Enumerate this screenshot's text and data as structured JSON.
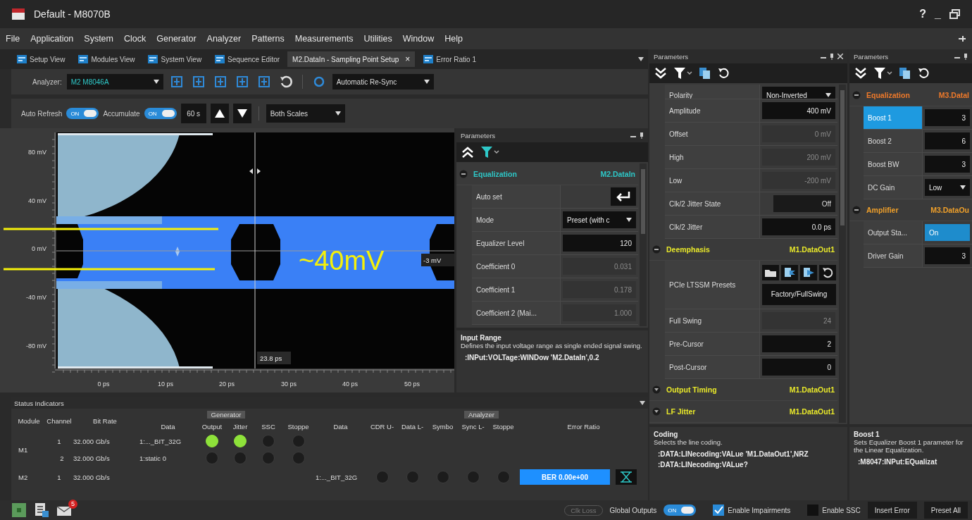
{
  "window": {
    "title": "Default - M8070B",
    "controls": [
      "?",
      "_"
    ]
  },
  "menu": [
    "File",
    "Application",
    "System",
    "Clock",
    "Generator",
    "Analyzer",
    "Patterns",
    "Measurements",
    "Utilities",
    "Window",
    "Help"
  ],
  "tabs": [
    {
      "label": "Setup View",
      "selected": false
    },
    {
      "label": "Modules View",
      "selected": false
    },
    {
      "label": "System View",
      "selected": false
    },
    {
      "label": "Sequence Editor",
      "selected": false
    },
    {
      "label": "M2.DataIn - Sampling Point Setup",
      "selected": true,
      "close": "×"
    },
    {
      "label": "Error Ratio 1",
      "selected": false
    }
  ],
  "toolbar": {
    "analyzer_label": "Analyzer:",
    "analyzer": "M2 M8046A",
    "resync": "Automatic Re-Sync"
  },
  "acquisition": {
    "toggles": [
      {
        "label": "Auto Refresh",
        "on": true,
        "text": "ON"
      },
      {
        "label": "Accumulate",
        "on": true,
        "text": "ON"
      }
    ],
    "interval": "60 s",
    "scale": "Both Scales"
  },
  "plot": {
    "y_labels": [
      "80 mV",
      "40 mV",
      "0 mV",
      "-40 mV",
      "-80 mV"
    ],
    "x_labels": [
      "0 ps",
      "10 ps",
      "20 ps",
      "30 ps",
      "40 ps",
      "50 ps"
    ],
    "time_cursor": "23.8 ps",
    "voltage_cursor": "-3 mV",
    "annotation": "~40mV"
  },
  "panels": [
    {
      "title": "Parameters",
      "sections": [
        {
          "name": "Equalization",
          "target": "M2.DataIn",
          "color": "#2ec8c8",
          "expanded": true,
          "rows": [
            {
              "label": "Auto set",
              "kind": "button"
            },
            {
              "label": "Mode",
              "kind": "select",
              "value": "Preset (with c"
            },
            {
              "label": "Equalizer Level",
              "kind": "input",
              "value": "120"
            },
            {
              "label": "Coefficient 0",
              "kind": "readonly",
              "value": "0.031"
            },
            {
              "label": "Coefficient 1",
              "kind": "readonly",
              "value": "0.178"
            },
            {
              "label": "Coefficient 2 (Mai...",
              "kind": "readonly",
              "value": "1.000"
            }
          ]
        }
      ],
      "help": {
        "title": "Input Range",
        "text": "Defines the input voltage range as single ended signal swing.",
        "commands": [
          ":INPut:VOLTage:WINDow 'M2.DataIn',0.2"
        ]
      }
    },
    {
      "title": "Parameters",
      "sections": [
        {
          "rows": [
            {
              "label": "Polarity",
              "kind": "select",
              "value": "Non-Inverted"
            },
            {
              "label": "Amplitude",
              "kind": "input",
              "value": "400 mV"
            },
            {
              "label": "Offset",
              "kind": "readonly",
              "value": "0 mV"
            },
            {
              "label": "High",
              "kind": "readonly",
              "value": "200 mV"
            },
            {
              "label": "Low",
              "kind": "readonly",
              "value": "-200 mV"
            },
            {
              "label": "Clk/2 Jitter State",
              "kind": "toggle",
              "on": false,
              "text": "Off"
            },
            {
              "label": "Clk/2 Jitter",
              "kind": "input",
              "value": "0.0 ps"
            }
          ]
        },
        {
          "name": "Deemphasis",
          "target": "M1.DataOut1",
          "color": "#e8e82a",
          "expanded": true,
          "rows": [
            {
              "label": "PCIe LTSSM Presets",
              "kind": "presets",
              "value": "Factory/FullSwing"
            },
            {
              "label": "Full Swing",
              "kind": "readonly",
              "value": "24"
            },
            {
              "label": "Pre-Cursor",
              "kind": "input",
              "value": "2"
            },
            {
              "label": "Post-Cursor",
              "kind": "input",
              "value": "0"
            }
          ]
        },
        {
          "name": "Output Timing",
          "target": "M1.DataOut1",
          "color": "#e8e82a",
          "expanded": false
        },
        {
          "name": "LF Jitter",
          "target": "M1.DataOut1",
          "color": "#e8e82a",
          "expanded": false
        }
      ],
      "help": {
        "title": "Coding",
        "text": "Selects the line coding.",
        "commands": [
          ":DATA:LINecoding:VALue 'M1.DataOut1',NRZ",
          ":DATA:LINecoding:VALue?"
        ]
      }
    },
    {
      "title": "Parameters",
      "sections": [
        {
          "name": "Equalization",
          "target": "M3.DataI",
          "color": "#f07a2a",
          "expanded": true,
          "rows": [
            {
              "label": "Boost 1",
              "kind": "input",
              "value": "3",
              "selected": true
            },
            {
              "label": "Boost 2",
              "kind": "input",
              "value": "6",
              "selected": false
            },
            {
              "label": "Boost BW",
              "kind": "input",
              "value": "3",
              "selected": false
            },
            {
              "label": "DC Gain",
              "kind": "select",
              "value": "Low",
              "selected": false
            }
          ]
        },
        {
          "name": "Amplifier",
          "target": "M3.DataOu",
          "color": "#f0a02a",
          "expanded": true,
          "rows": [
            {
              "label": "Output Sta...",
              "kind": "toggle",
              "on": true,
              "text": "On",
              "selected": false
            },
            {
              "label": "Driver Gain",
              "kind": "input",
              "value": "3",
              "selected": false
            }
          ]
        }
      ],
      "help": {
        "title": "Boost 1",
        "text": "Sets Equalizer Boost 1 parameter for the Linear Equalization.",
        "commands": [
          ":M8047:INPut:EQualizat"
        ]
      }
    }
  ],
  "status": {
    "title": "Status Indicators",
    "module_head": "Module",
    "channel_head": "Channel",
    "rate_head": "Bit Rate",
    "generator": {
      "title": "Generator",
      "columns": [
        "Data",
        "Output",
        "Jitter",
        "SSC",
        "Stoppe"
      ]
    },
    "analyzer": {
      "title": "Analyzer",
      "columns": [
        "Data",
        "CDR U-",
        "Data L-",
        "Symbo",
        "Sync L-",
        "Stoppe",
        "Error Ratio"
      ]
    },
    "modules": [
      {
        "name": "M1",
        "channels": [
          {
            "channel": "1",
            "rate": "32.000 Gb/s",
            "gen_data": "1:..._BIT_32G",
            "gen_leds": [
              true,
              true,
              false,
              false
            ]
          },
          {
            "channel": "2",
            "rate": "32.000 Gb/s",
            "gen_data": "1:static 0",
            "gen_leds": [
              false,
              false,
              false,
              false
            ]
          }
        ]
      },
      {
        "name": "M2",
        "channels": [
          {
            "channel": "1",
            "rate": "32.000 Gb/s",
            "ana_data": "1:..._BIT_32G",
            "ana_leds": [
              false,
              false,
              false,
              false,
              false
            ],
            "ber": "BER 0.00e+00"
          }
        ]
      }
    ]
  },
  "footer": {
    "badge": "5",
    "clk_loss": {
      "label": "Clk Loss",
      "disabled": true
    },
    "global_outputs": {
      "label": "Global Outputs",
      "on": true,
      "text": "ON"
    },
    "checks": [
      {
        "label": "Enable Impairments",
        "checked": true
      },
      {
        "label": "Enable SSC",
        "checked": false
      }
    ],
    "buttons": [
      "Insert Error",
      "Preset All"
    ]
  }
}
